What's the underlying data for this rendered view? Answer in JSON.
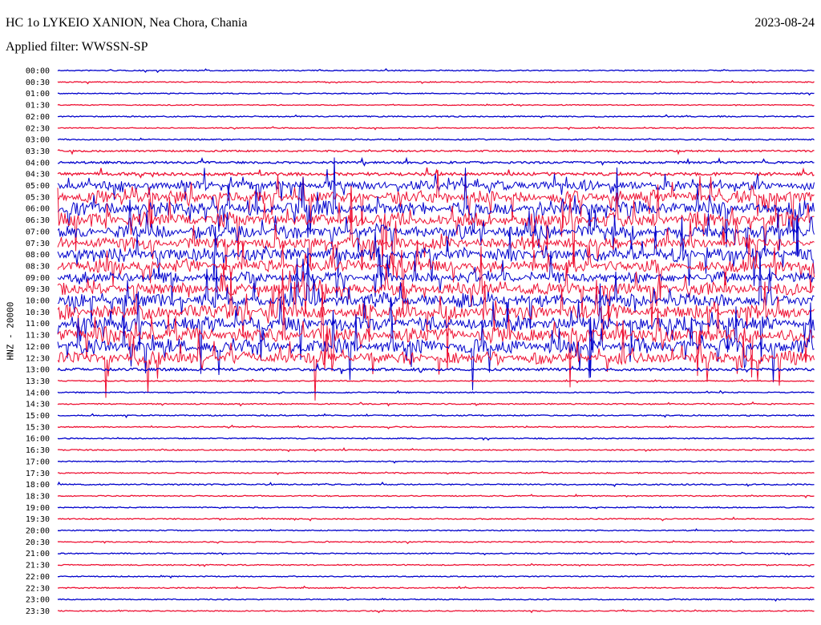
{
  "header": {
    "station": "HC 1o LYKEIO XANION, Nea Chora, Chania",
    "date": "2023-08-24",
    "filter": "Applied filter: WWSSN-SP",
    "channel_label": "HNZ - 20000"
  },
  "colors": {
    "line_a": "#0000cc",
    "line_b": "#ee1133",
    "text": "#000000"
  },
  "chart_data": {
    "type": "line",
    "title": "HC 1o LYKEIO XANION, Nea Chora, Chania",
    "ylabel": "HNZ - 20000",
    "rows": [
      {
        "label": "00:00",
        "activity": 0.05
      },
      {
        "label": "00:30",
        "activity": 0.04
      },
      {
        "label": "01:00",
        "activity": 0.04
      },
      {
        "label": "01:30",
        "activity": 0.03
      },
      {
        "label": "02:00",
        "activity": 0.06
      },
      {
        "label": "02:30",
        "activity": 0.04
      },
      {
        "label": "03:00",
        "activity": 0.06
      },
      {
        "label": "03:30",
        "activity": 0.12
      },
      {
        "label": "04:00",
        "activity": 0.18
      },
      {
        "label": "04:30",
        "activity": 0.3
      },
      {
        "label": "05:00",
        "activity": 0.6
      },
      {
        "label": "05:30",
        "activity": 0.85
      },
      {
        "label": "06:00",
        "activity": 1.0
      },
      {
        "label": "06:30",
        "activity": 1.0
      },
      {
        "label": "07:00",
        "activity": 0.9
      },
      {
        "label": "07:30",
        "activity": 0.8
      },
      {
        "label": "08:00",
        "activity": 0.9
      },
      {
        "label": "08:30",
        "activity": 0.85
      },
      {
        "label": "09:00",
        "activity": 0.7
      },
      {
        "label": "09:30",
        "activity": 0.8
      },
      {
        "label": "10:00",
        "activity": 0.95
      },
      {
        "label": "10:30",
        "activity": 1.0
      },
      {
        "label": "11:00",
        "activity": 1.0
      },
      {
        "label": "11:30",
        "activity": 1.0
      },
      {
        "label": "12:00",
        "activity": 1.0
      },
      {
        "label": "12:30",
        "activity": 0.85
      },
      {
        "label": "13:00",
        "activity": 0.25
      },
      {
        "label": "13:30",
        "activity": 0.06
      },
      {
        "label": "14:00",
        "activity": 0.05
      },
      {
        "label": "14:30",
        "activity": 0.06
      },
      {
        "label": "15:00",
        "activity": 0.06
      },
      {
        "label": "15:30",
        "activity": 0.05
      },
      {
        "label": "16:00",
        "activity": 0.05
      },
      {
        "label": "16:30",
        "activity": 0.06
      },
      {
        "label": "17:00",
        "activity": 0.05
      },
      {
        "label": "17:30",
        "activity": 0.05
      },
      {
        "label": "18:00",
        "activity": 0.07
      },
      {
        "label": "18:30",
        "activity": 0.05
      },
      {
        "label": "19:00",
        "activity": 0.04
      },
      {
        "label": "19:30",
        "activity": 0.05
      },
      {
        "label": "20:00",
        "activity": 0.05
      },
      {
        "label": "20:30",
        "activity": 0.04
      },
      {
        "label": "21:00",
        "activity": 0.05
      },
      {
        "label": "21:30",
        "activity": 0.05
      },
      {
        "label": "22:00",
        "activity": 0.04
      },
      {
        "label": "22:30",
        "activity": 0.05
      },
      {
        "label": "23:00",
        "activity": 0.05
      },
      {
        "label": "23:30",
        "activity": 0.04
      }
    ]
  }
}
